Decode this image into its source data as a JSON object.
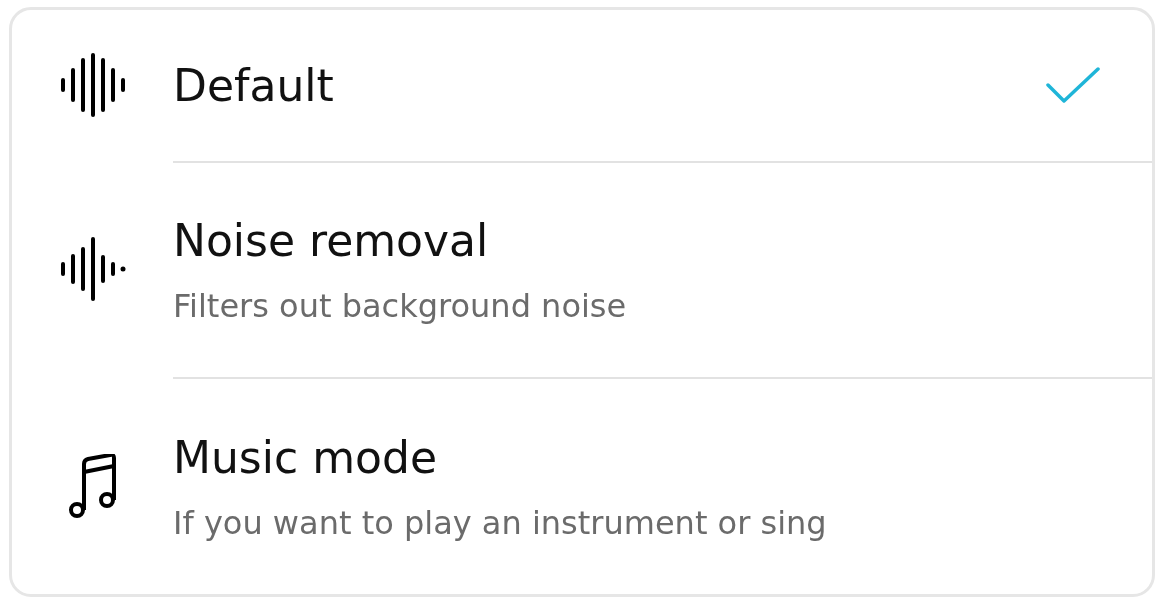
{
  "options": [
    {
      "kind": "waveform",
      "title": "Default",
      "selected": true
    },
    {
      "kind": "waveform-reduced",
      "title": "Noise removal",
      "subtitle": "Filters out background noise",
      "selected": false
    },
    {
      "kind": "music-note",
      "title": "Music mode",
      "subtitle": "If you want to play an instrument or sing",
      "selected": false
    }
  ]
}
